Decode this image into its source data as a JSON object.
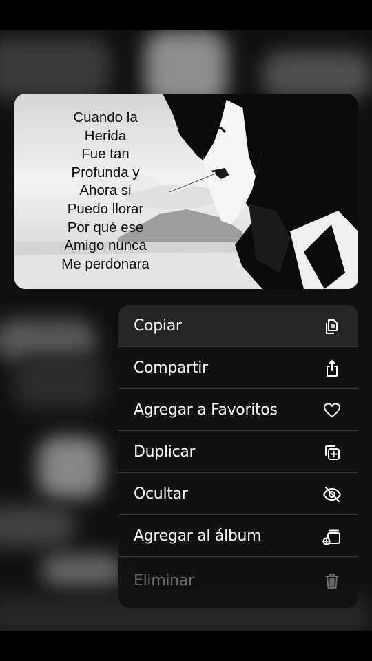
{
  "preview": {
    "lyrics": [
      "Cuando la",
      "Herida",
      "Fue tan",
      "Profunda y",
      "Ahora si",
      "Puedo llorar",
      "Por qué ese",
      "Amigo nunca",
      "Me perdonara"
    ]
  },
  "context_menu": {
    "items": [
      {
        "label": "Copiar",
        "icon": "copy-icon"
      },
      {
        "label": "Compartir",
        "icon": "share-icon"
      },
      {
        "label": "Agregar a Favoritos",
        "icon": "heart-icon"
      },
      {
        "label": "Duplicar",
        "icon": "duplicate-icon"
      },
      {
        "label": "Ocultar",
        "icon": "eye-slash-icon"
      },
      {
        "label": "Agregar al álbum",
        "icon": "add-to-album-icon"
      },
      {
        "label": "Eliminar",
        "icon": "trash-icon"
      }
    ]
  },
  "colors": {
    "menu_background": "#121212",
    "menu_text": "#fafafa",
    "disabled_text": "#6b6b6b"
  }
}
